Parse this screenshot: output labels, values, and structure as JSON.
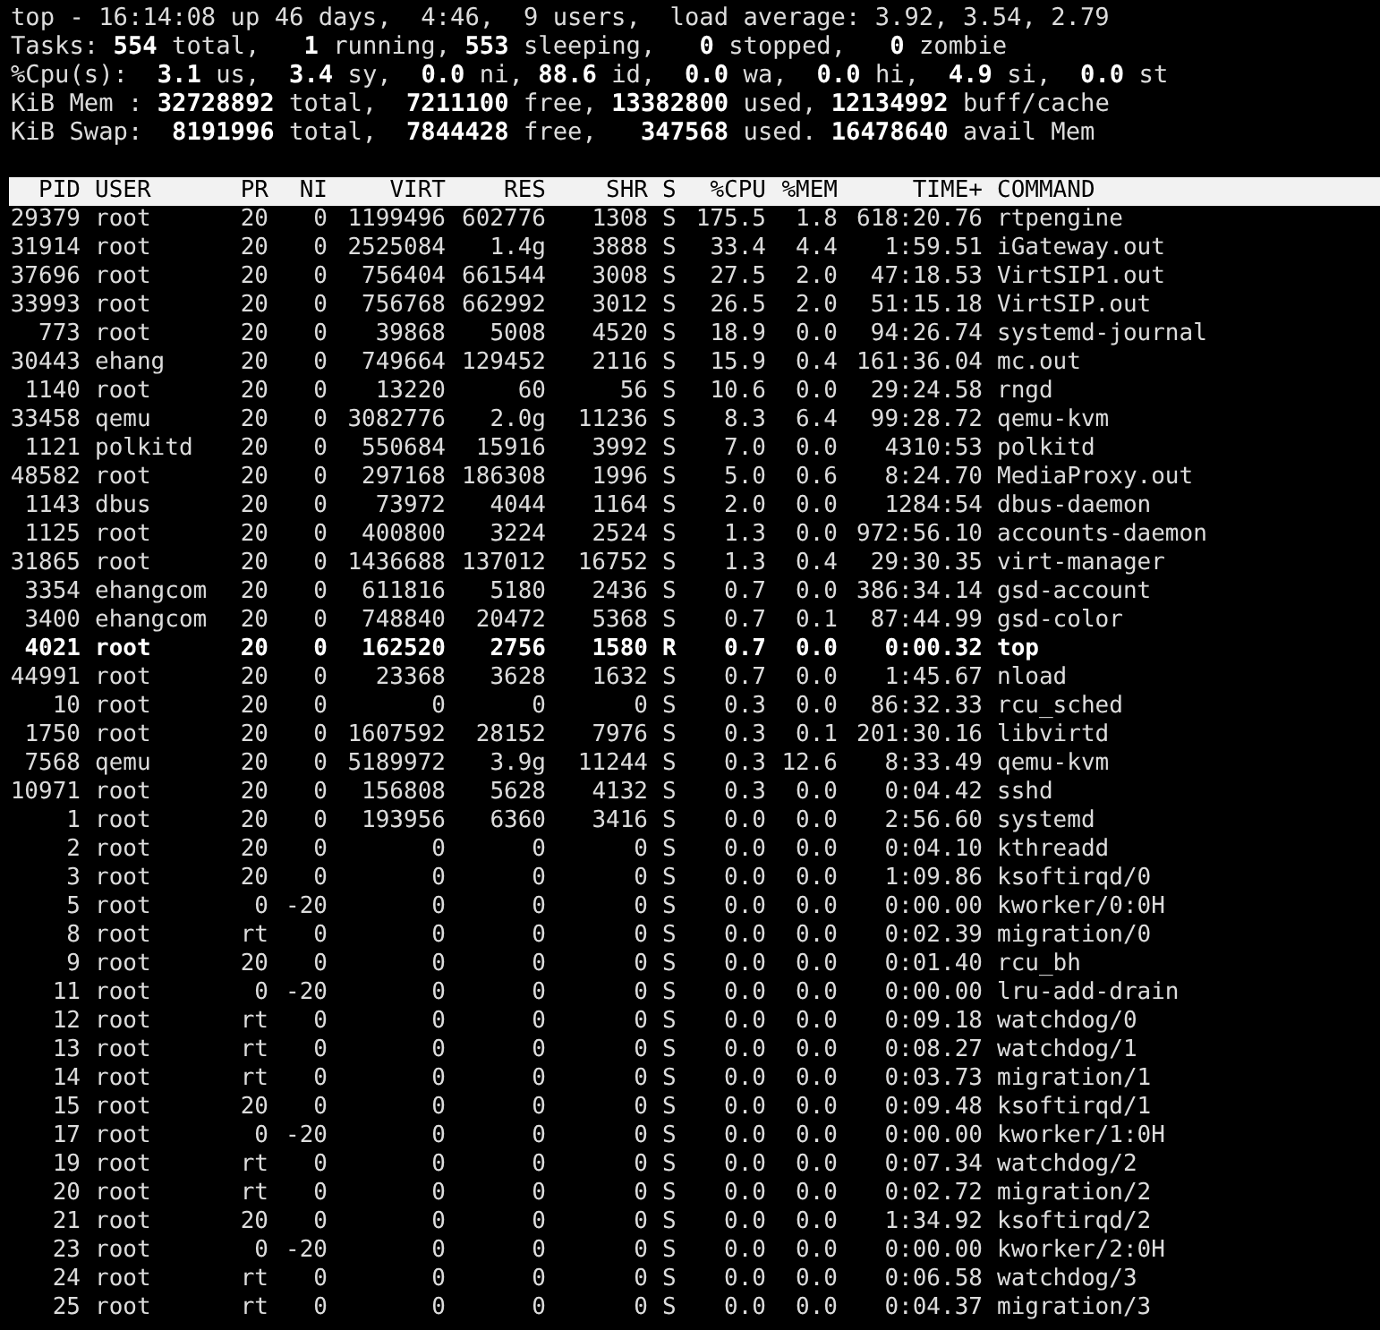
{
  "summary": [
    "top - 16:14:08 up 46 days,  4:46,  9 users,  load average: 3.92, 3.54, 2.79",
    "Tasks: **554** total,   **1** running, **553** sleeping,   **0** stopped,   **0** zombie",
    "%Cpu(s):  **3.1** us,  **3.4** sy,  **0.0** ni, **88.6** id,  **0.0** wa,  **0.0** hi,  **4.9** si,  **0.0** st",
    "KiB Mem : **32728892** total,  **7211100** free, **13382800** used, **12134992** buff/cache",
    "KiB Swap:  **8191996** total,  **7844428** free,   **347568** used. **16478640** avail Mem"
  ],
  "table": {
    "columns": [
      "PID",
      "USER",
      "PR",
      "NI",
      "VIRT",
      "RES",
      "SHR",
      "S",
      "%CPU",
      "%MEM",
      "TIME+",
      "COMMAND"
    ],
    "rows": [
      {
        "cells": [
          "29379",
          "root",
          "20",
          "0",
          "1199496",
          "602776",
          "1308",
          "S",
          "175.5",
          "1.8",
          "618:20.76",
          "rtpengine"
        ],
        "highlighted": false
      },
      {
        "cells": [
          "31914",
          "root",
          "20",
          "0",
          "2525084",
          "1.4g",
          "3888",
          "S",
          "33.4",
          "4.4",
          "1:59.51",
          "iGateway.out"
        ],
        "highlighted": false
      },
      {
        "cells": [
          "37696",
          "root",
          "20",
          "0",
          "756404",
          "661544",
          "3008",
          "S",
          "27.5",
          "2.0",
          "47:18.53",
          "VirtSIP1.out"
        ],
        "highlighted": false
      },
      {
        "cells": [
          "33993",
          "root",
          "20",
          "0",
          "756768",
          "662992",
          "3012",
          "S",
          "26.5",
          "2.0",
          "51:15.18",
          "VirtSIP.out"
        ],
        "highlighted": false
      },
      {
        "cells": [
          "773",
          "root",
          "20",
          "0",
          "39868",
          "5008",
          "4520",
          "S",
          "18.9",
          "0.0",
          "94:26.74",
          "systemd-journal"
        ],
        "highlighted": false
      },
      {
        "cells": [
          "30443",
          "ehang",
          "20",
          "0",
          "749664",
          "129452",
          "2116",
          "S",
          "15.9",
          "0.4",
          "161:36.04",
          "mc.out"
        ],
        "highlighted": false
      },
      {
        "cells": [
          "1140",
          "root",
          "20",
          "0",
          "13220",
          "60",
          "56",
          "S",
          "10.6",
          "0.0",
          "29:24.58",
          "rngd"
        ],
        "highlighted": false
      },
      {
        "cells": [
          "33458",
          "qemu",
          "20",
          "0",
          "3082776",
          "2.0g",
          "11236",
          "S",
          "8.3",
          "6.4",
          "99:28.72",
          "qemu-kvm"
        ],
        "highlighted": false
      },
      {
        "cells": [
          "1121",
          "polkitd",
          "20",
          "0",
          "550684",
          "15916",
          "3992",
          "S",
          "7.0",
          "0.0",
          "4310:53",
          "polkitd"
        ],
        "highlighted": false
      },
      {
        "cells": [
          "48582",
          "root",
          "20",
          "0",
          "297168",
          "186308",
          "1996",
          "S",
          "5.0",
          "0.6",
          "8:24.70",
          "MediaProxy.out"
        ],
        "highlighted": false
      },
      {
        "cells": [
          "1143",
          "dbus",
          "20",
          "0",
          "73972",
          "4044",
          "1164",
          "S",
          "2.0",
          "0.0",
          "1284:54",
          "dbus-daemon"
        ],
        "highlighted": false
      },
      {
        "cells": [
          "1125",
          "root",
          "20",
          "0",
          "400800",
          "3224",
          "2524",
          "S",
          "1.3",
          "0.0",
          "972:56.10",
          "accounts-daemon"
        ],
        "highlighted": false
      },
      {
        "cells": [
          "31865",
          "root",
          "20",
          "0",
          "1436688",
          "137012",
          "16752",
          "S",
          "1.3",
          "0.4",
          "29:30.35",
          "virt-manager"
        ],
        "highlighted": false
      },
      {
        "cells": [
          "3354",
          "ehangcom",
          "20",
          "0",
          "611816",
          "5180",
          "2436",
          "S",
          "0.7",
          "0.0",
          "386:34.14",
          "gsd-account"
        ],
        "highlighted": false
      },
      {
        "cells": [
          "3400",
          "ehangcom",
          "20",
          "0",
          "748840",
          "20472",
          "5368",
          "S",
          "0.7",
          "0.1",
          "87:44.99",
          "gsd-color"
        ],
        "highlighted": false
      },
      {
        "cells": [
          "4021",
          "root",
          "20",
          "0",
          "162520",
          "2756",
          "1580",
          "R",
          "0.7",
          "0.0",
          "0:00.32",
          "top"
        ],
        "highlighted": true
      },
      {
        "cells": [
          "44991",
          "root",
          "20",
          "0",
          "23368",
          "3628",
          "1632",
          "S",
          "0.7",
          "0.0",
          "1:45.67",
          "nload"
        ],
        "highlighted": false
      },
      {
        "cells": [
          "10",
          "root",
          "20",
          "0",
          "0",
          "0",
          "0",
          "S",
          "0.3",
          "0.0",
          "86:32.33",
          "rcu_sched"
        ],
        "highlighted": false
      },
      {
        "cells": [
          "1750",
          "root",
          "20",
          "0",
          "1607592",
          "28152",
          "7976",
          "S",
          "0.3",
          "0.1",
          "201:30.16",
          "libvirtd"
        ],
        "highlighted": false
      },
      {
        "cells": [
          "7568",
          "qemu",
          "20",
          "0",
          "5189972",
          "3.9g",
          "11244",
          "S",
          "0.3",
          "12.6",
          "8:33.49",
          "qemu-kvm"
        ],
        "highlighted": false
      },
      {
        "cells": [
          "10971",
          "root",
          "20",
          "0",
          "156808",
          "5628",
          "4132",
          "S",
          "0.3",
          "0.0",
          "0:04.42",
          "sshd"
        ],
        "highlighted": false
      },
      {
        "cells": [
          "1",
          "root",
          "20",
          "0",
          "193956",
          "6360",
          "3416",
          "S",
          "0.0",
          "0.0",
          "2:56.60",
          "systemd"
        ],
        "highlighted": false
      },
      {
        "cells": [
          "2",
          "root",
          "20",
          "0",
          "0",
          "0",
          "0",
          "S",
          "0.0",
          "0.0",
          "0:04.10",
          "kthreadd"
        ],
        "highlighted": false
      },
      {
        "cells": [
          "3",
          "root",
          "20",
          "0",
          "0",
          "0",
          "0",
          "S",
          "0.0",
          "0.0",
          "1:09.86",
          "ksoftirqd/0"
        ],
        "highlighted": false
      },
      {
        "cells": [
          "5",
          "root",
          "0",
          "-20",
          "0",
          "0",
          "0",
          "S",
          "0.0",
          "0.0",
          "0:00.00",
          "kworker/0:0H"
        ],
        "highlighted": false
      },
      {
        "cells": [
          "8",
          "root",
          "rt",
          "0",
          "0",
          "0",
          "0",
          "S",
          "0.0",
          "0.0",
          "0:02.39",
          "migration/0"
        ],
        "highlighted": false
      },
      {
        "cells": [
          "9",
          "root",
          "20",
          "0",
          "0",
          "0",
          "0",
          "S",
          "0.0",
          "0.0",
          "0:01.40",
          "rcu_bh"
        ],
        "highlighted": false
      },
      {
        "cells": [
          "11",
          "root",
          "0",
          "-20",
          "0",
          "0",
          "0",
          "S",
          "0.0",
          "0.0",
          "0:00.00",
          "lru-add-drain"
        ],
        "highlighted": false
      },
      {
        "cells": [
          "12",
          "root",
          "rt",
          "0",
          "0",
          "0",
          "0",
          "S",
          "0.0",
          "0.0",
          "0:09.18",
          "watchdog/0"
        ],
        "highlighted": false
      },
      {
        "cells": [
          "13",
          "root",
          "rt",
          "0",
          "0",
          "0",
          "0",
          "S",
          "0.0",
          "0.0",
          "0:08.27",
          "watchdog/1"
        ],
        "highlighted": false
      },
      {
        "cells": [
          "14",
          "root",
          "rt",
          "0",
          "0",
          "0",
          "0",
          "S",
          "0.0",
          "0.0",
          "0:03.73",
          "migration/1"
        ],
        "highlighted": false
      },
      {
        "cells": [
          "15",
          "root",
          "20",
          "0",
          "0",
          "0",
          "0",
          "S",
          "0.0",
          "0.0",
          "0:09.48",
          "ksoftirqd/1"
        ],
        "highlighted": false
      },
      {
        "cells": [
          "17",
          "root",
          "0",
          "-20",
          "0",
          "0",
          "0",
          "S",
          "0.0",
          "0.0",
          "0:00.00",
          "kworker/1:0H"
        ],
        "highlighted": false
      },
      {
        "cells": [
          "19",
          "root",
          "rt",
          "0",
          "0",
          "0",
          "0",
          "S",
          "0.0",
          "0.0",
          "0:07.34",
          "watchdog/2"
        ],
        "highlighted": false
      },
      {
        "cells": [
          "20",
          "root",
          "rt",
          "0",
          "0",
          "0",
          "0",
          "S",
          "0.0",
          "0.0",
          "0:02.72",
          "migration/2"
        ],
        "highlighted": false
      },
      {
        "cells": [
          "21",
          "root",
          "20",
          "0",
          "0",
          "0",
          "0",
          "S",
          "0.0",
          "0.0",
          "1:34.92",
          "ksoftirqd/2"
        ],
        "highlighted": false
      },
      {
        "cells": [
          "23",
          "root",
          "0",
          "-20",
          "0",
          "0",
          "0",
          "S",
          "0.0",
          "0.0",
          "0:00.00",
          "kworker/2:0H"
        ],
        "highlighted": false
      },
      {
        "cells": [
          "24",
          "root",
          "rt",
          "0",
          "0",
          "0",
          "0",
          "S",
          "0.0",
          "0.0",
          "0:06.58",
          "watchdog/3"
        ],
        "highlighted": false
      },
      {
        "cells": [
          "25",
          "root",
          "rt",
          "0",
          "0",
          "0",
          "0",
          "S",
          "0.0",
          "0.0",
          "0:04.37",
          "migration/3"
        ],
        "highlighted": false
      }
    ]
  }
}
